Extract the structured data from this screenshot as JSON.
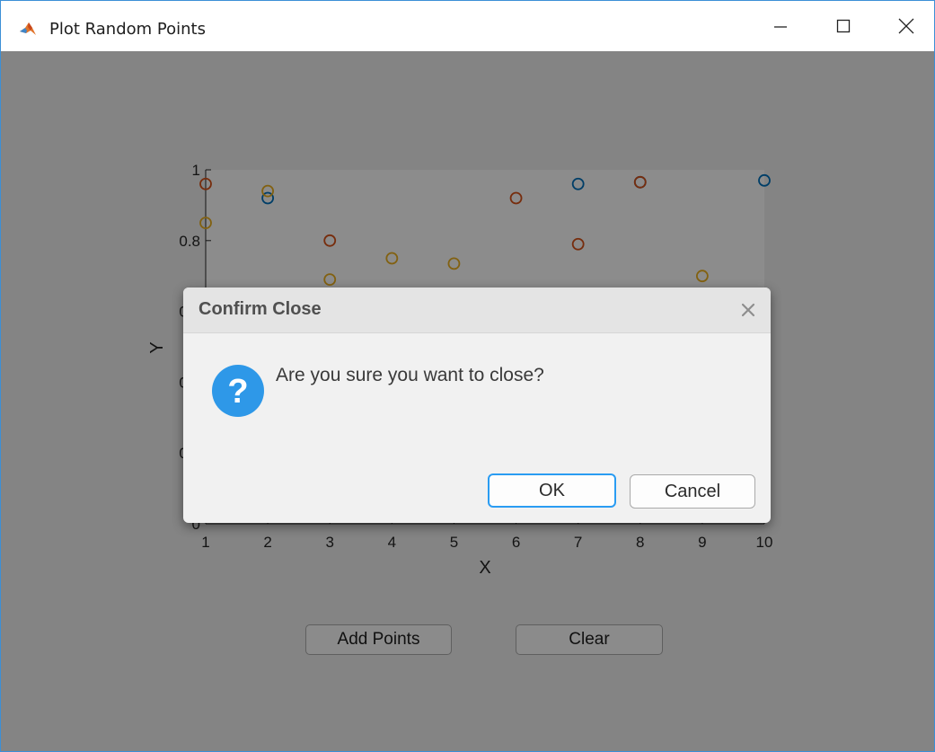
{
  "window": {
    "title": "Plot Random Points",
    "app_icon": "matlab-icon",
    "controls": [
      "minimize-icon",
      "maximize-icon",
      "close-icon"
    ]
  },
  "axes": {
    "xlabel": "X",
    "ylabel": "Y",
    "xticks": [
      "1",
      "2",
      "3",
      "4",
      "5",
      "6",
      "7",
      "8",
      "9",
      "10"
    ],
    "yticks": [
      "0",
      "0.2",
      "0.4",
      "0.6",
      "0.8",
      "1"
    ]
  },
  "chart_data": {
    "type": "scatter",
    "x": [
      1,
      2,
      3,
      4,
      5,
      6,
      7,
      8,
      9,
      10
    ],
    "xlim": [
      1,
      10
    ],
    "ylim": [
      0,
      1
    ],
    "series": [
      {
        "color": "#0072bd",
        "points": [
          [
            2,
            0.92
          ],
          [
            7,
            0.96
          ],
          [
            8,
            0.965
          ],
          [
            10,
            0.97
          ]
        ]
      },
      {
        "color": "#d95319",
        "points": [
          [
            1,
            0.96
          ],
          [
            3,
            0.8
          ],
          [
            6,
            0.92
          ],
          [
            7,
            0.79
          ],
          [
            8,
            0.965
          ]
        ]
      },
      {
        "color": "#edb120",
        "points": [
          [
            1,
            0.85
          ],
          [
            2,
            0.94
          ],
          [
            3,
            0.69
          ],
          [
            4,
            0.75
          ],
          [
            5,
            0.735
          ],
          [
            7,
            0.65
          ],
          [
            9,
            0.7
          ]
        ]
      }
    ]
  },
  "buttons": {
    "add_points": "Add Points",
    "clear": "Clear"
  },
  "dialog": {
    "title": "Confirm Close",
    "message": "Are you sure you want to close?",
    "icon": "question-icon",
    "ok_label": "OK",
    "cancel_label": "Cancel"
  }
}
